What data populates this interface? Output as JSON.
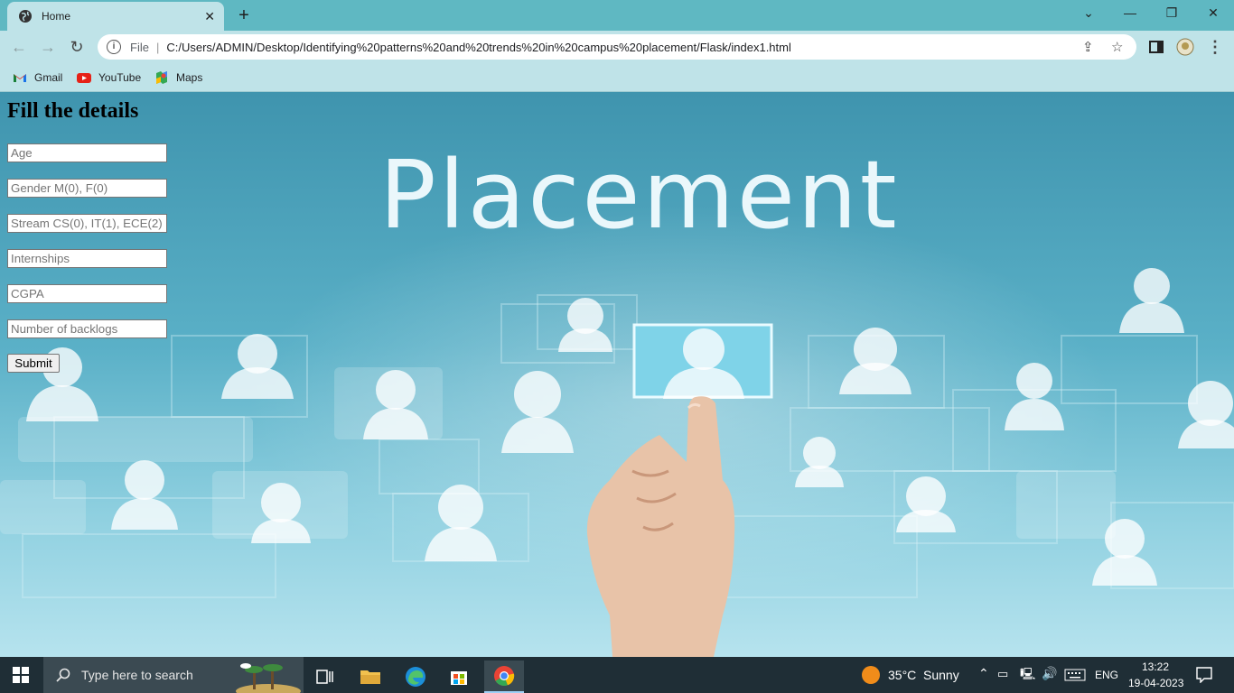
{
  "browser": {
    "tab_title": "Home",
    "new_tab": "+",
    "address": {
      "scheme": "File",
      "url": "C:/Users/ADMIN/Desktop/Identifying%20patterns%20and%20trends%20in%20campus%20placement/Flask/index1.html"
    },
    "bookmarks": [
      {
        "label": "Gmail",
        "icon": "gmail-icon"
      },
      {
        "label": "YouTube",
        "icon": "youtube-icon"
      },
      {
        "label": "Maps",
        "icon": "maps-icon"
      }
    ]
  },
  "page": {
    "banner_text": "Placement",
    "form": {
      "heading": "Fill the details",
      "fields": [
        {
          "placeholder": "Age"
        },
        {
          "placeholder": "Gender M(0), F(0)"
        },
        {
          "placeholder": "Stream CS(0), IT(1), ECE(2)"
        },
        {
          "placeholder": "Internships"
        },
        {
          "placeholder": "CGPA"
        },
        {
          "placeholder": "Number of backlogs"
        }
      ],
      "submit_label": "Submit"
    }
  },
  "taskbar": {
    "search_placeholder": "Type here to search",
    "weather": {
      "temp": "35°C",
      "condition": "Sunny"
    },
    "language": "ENG",
    "time": "13:22",
    "date": "19-04-2023"
  },
  "colors": {
    "chrome_bg": "#5fb8c2",
    "toolbar_bg": "#bfe3e8",
    "taskbar_bg": "#1f2e36"
  }
}
